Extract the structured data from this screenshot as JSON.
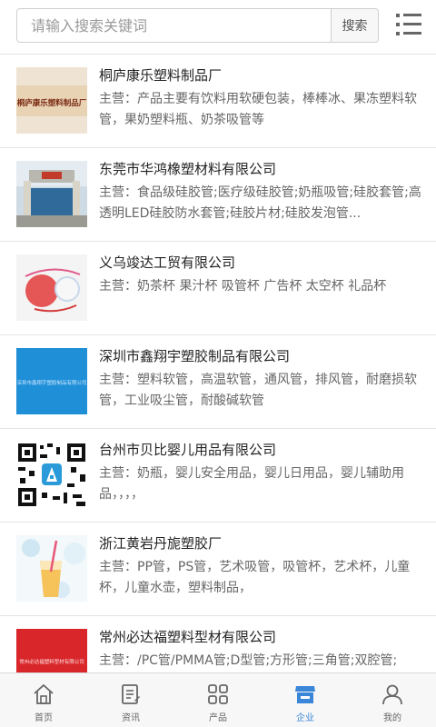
{
  "search": {
    "placeholder": "请输入搜索关键词",
    "button_label": "搜索"
  },
  "companies": [
    {
      "name": "桐庐康乐塑料制品厂",
      "desc": "主营：产品主要有饮料用软硬包装，棒棒冰、果冻塑料软管，果奶塑料瓶、奶茶吸管等",
      "thumb_text": "桐庐康乐塑料制品厂"
    },
    {
      "name": "东莞市华鸿橡塑材料有限公司",
      "desc": "主营：食品级硅胶管;医疗级硅胶管;奶瓶吸管;硅胶套管;高透明LED硅胶防水套管;硅胶片材;硅胶发泡管..."
    },
    {
      "name": "义乌竣达工贸有限公司",
      "desc": "主营：奶茶杯 果汁杯 吸管杯 广告杯 太空杯 礼品杯"
    },
    {
      "name": "深圳市鑫翔宇塑胶制品有限公司",
      "desc": "主营：塑料软管，高温软管，通风管，排风管，耐磨损软管，工业吸尘管，耐酸碱软管",
      "thumb_text": "深圳市鑫翔宇塑胶制品有限公司"
    },
    {
      "name": "台州市贝比婴儿用品有限公司",
      "desc": "主营：奶瓶，婴儿安全用品，婴儿日用品，婴儿辅助用品，，，，"
    },
    {
      "name": "浙江黄岩丹旎塑胶厂",
      "desc": "主营：PP管，PS管，艺术吸管，吸管杯，艺术杯，儿童杯，儿童水壶，塑料制品，"
    },
    {
      "name": "常州必达福塑料型材有限公司",
      "desc": "主营：/PC管/PMMA管;D型管;方形管;三角管;双腔管;",
      "thumb_text": "常州必达福塑料型材有限公司"
    }
  ],
  "tabbar": {
    "items": [
      {
        "label": "首页",
        "icon": "home-icon"
      },
      {
        "label": "资讯",
        "icon": "news-icon"
      },
      {
        "label": "产品",
        "icon": "grid-icon"
      },
      {
        "label": "企业",
        "icon": "shop-icon",
        "active": true
      },
      {
        "label": "我的",
        "icon": "user-icon"
      }
    ]
  },
  "colors": {
    "active": "#3a86d8",
    "inactive": "#666666",
    "border": "#e4e4e4"
  }
}
